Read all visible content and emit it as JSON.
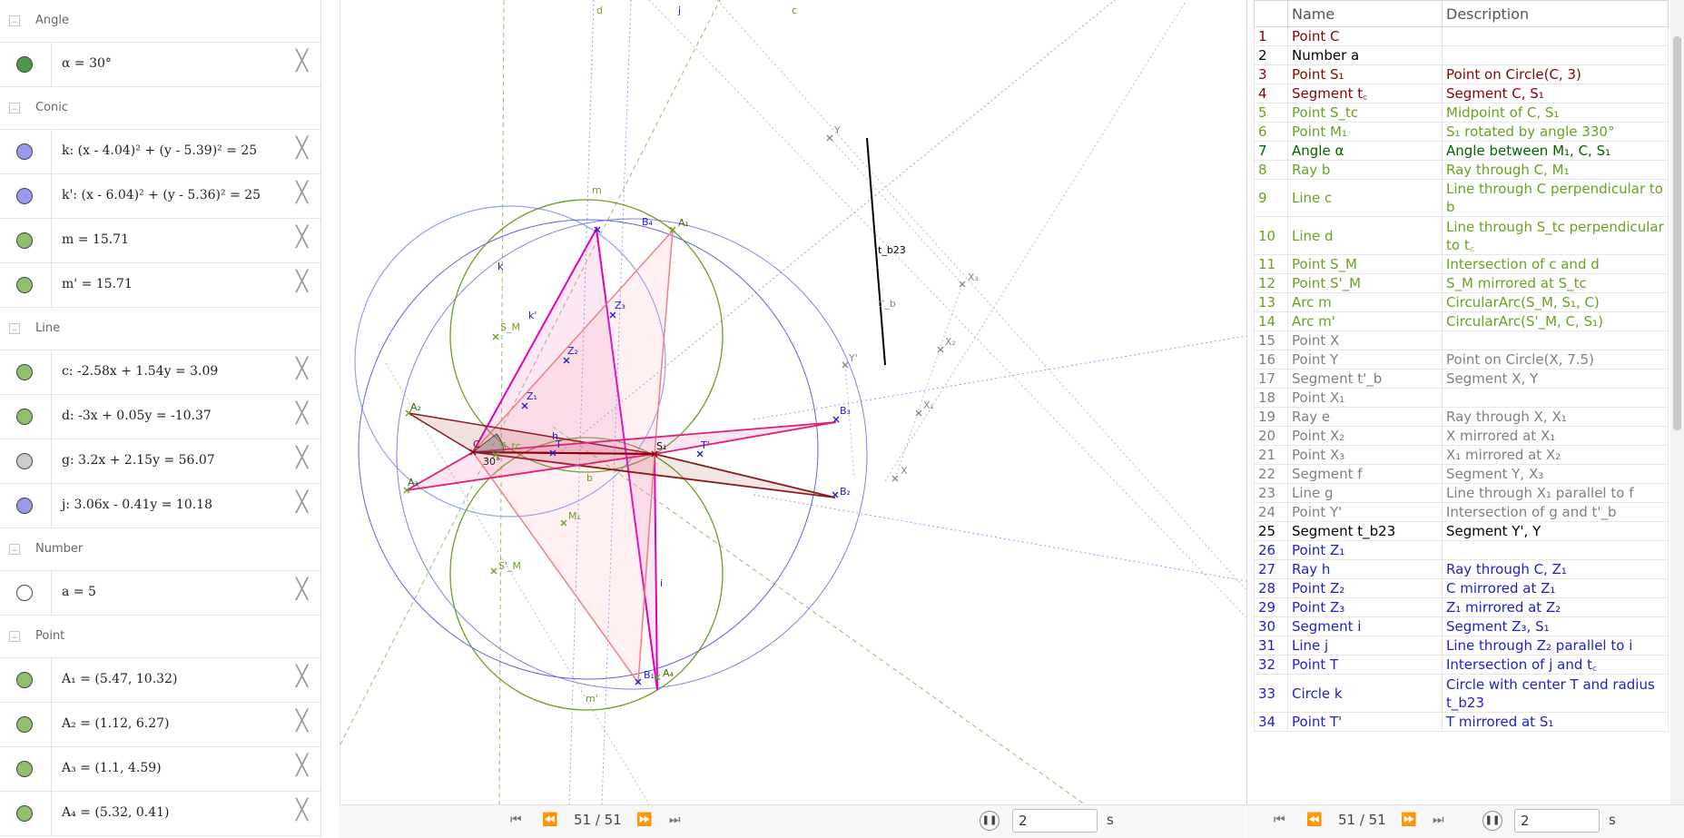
{
  "algebra": {
    "sections": [
      {
        "category": "Angle",
        "items": [
          {
            "expr": "α = 30°",
            "color": "#4a9a4a"
          }
        ]
      },
      {
        "category": "Conic",
        "items": [
          {
            "expr": "k: (x - 4.04)² + (y - 5.39)² = 25",
            "color": "#9999ee"
          },
          {
            "expr": "k': (x - 6.04)² + (y - 5.36)² = 25",
            "color": "#9999ee"
          },
          {
            "expr": "m = 15.71",
            "color": "#8fc06a"
          },
          {
            "expr": "m' = 15.71",
            "color": "#8fc06a"
          }
        ]
      },
      {
        "category": "Line",
        "items": [
          {
            "expr": "c: -2.58x + 1.54y = 3.09",
            "color": "#8fc06a"
          },
          {
            "expr": "d: -3x + 0.05y = -10.37",
            "color": "#8fc06a"
          },
          {
            "expr": "g: 3.2x + 2.15y = 56.07",
            "color": "#cccccc"
          },
          {
            "expr": "j: 3.06x - 0.41y = 10.18",
            "color": "#9999ee"
          }
        ]
      },
      {
        "category": "Number",
        "items": [
          {
            "expr": "a = 5",
            "color": "#ffffff"
          }
        ]
      },
      {
        "category": "Point",
        "items": [
          {
            "expr": "A₁ = (5.47, 10.32)",
            "color": "#8fc06a"
          },
          {
            "expr": "A₂ = (1.12, 6.27)",
            "color": "#8fc06a"
          },
          {
            "expr": "A₃ = (1.1, 4.59)",
            "color": "#8fc06a"
          },
          {
            "expr": "A₄ = (5.32, 0.41)",
            "color": "#8fc06a"
          }
        ]
      }
    ],
    "delete_symbol": "╳",
    "toggle_symbol": "–"
  },
  "graphics": {
    "labels": {
      "d": "d",
      "j": "j",
      "c": "c",
      "m": "m",
      "m_prime": "m'",
      "k": "k",
      "k_prime": "k'",
      "b": "b",
      "h": "h",
      "i": "i",
      "A1": "A₁",
      "A2": "A₂",
      "A3": "A₃",
      "A4": "A₄",
      "B1": "B₁",
      "B2": "B₂",
      "B3": "B₃",
      "B4": "B₄",
      "C": "C",
      "S1": "S₁",
      "T": "T",
      "T_prime": "T'",
      "Z1": "Z₁",
      "Z2": "Z₂",
      "Z3": "Z₃",
      "SM": "S_M",
      "S_prime_M": "S'_M",
      "M1": "M₁",
      "Stc": "S_tc",
      "angle": "30°",
      "X": "X",
      "X1": "X₁",
      "X2": "X₂",
      "X3": "X₃",
      "Y": "Y",
      "Y_prime": "Y'",
      "tb23": "t_b23",
      "t_prime_b": "t'_b"
    }
  },
  "playback": {
    "counter": "51 / 51",
    "speed_value": "2",
    "speed_unit": "s",
    "first_icon": "⏮",
    "prev_icon": "⏪",
    "next_icon": "⏩",
    "last_icon": "⏭",
    "pause_icon": "❚❚"
  },
  "protocol": {
    "header": {
      "name": "Name",
      "description": "Description"
    },
    "menu_icon": "⋮",
    "rows": [
      {
        "n": "1",
        "name": "Point C",
        "desc": "",
        "color": "#8b0000"
      },
      {
        "n": "2",
        "name": "Number a",
        "desc": "",
        "color": "#000000"
      },
      {
        "n": "3",
        "name": "Point S₁",
        "desc": "Point on Circle(C, 3)",
        "color": "#8b0000"
      },
      {
        "n": "4",
        "name": "Segment t꜀",
        "desc": "Segment C, S₁",
        "color": "#8b0000"
      },
      {
        "n": "5",
        "name": "Point S_tc",
        "desc": "Midpoint of C, S₁",
        "color": "#6aa121"
      },
      {
        "n": "6",
        "name": "Point M₁",
        "desc": "S₁ rotated by angle 330°",
        "color": "#6aa121"
      },
      {
        "n": "7",
        "name": "Angle α",
        "desc": "Angle between M₁, C, S₁",
        "color": "#006400"
      },
      {
        "n": "8",
        "name": "Ray b",
        "desc": "Ray through C, M₁",
        "color": "#6aa121"
      },
      {
        "n": "9",
        "name": "Line c",
        "desc": "Line through C perpendicular to b",
        "color": "#6aa121"
      },
      {
        "n": "10",
        "name": "Line d",
        "desc": "Line through S_tc perpendicular to t꜀",
        "color": "#6aa121"
      },
      {
        "n": "11",
        "name": "Point S_M",
        "desc": "Intersection of c and d",
        "color": "#6aa121"
      },
      {
        "n": "12",
        "name": "Point S'_M",
        "desc": "S_M mirrored at S_tc",
        "color": "#6aa121"
      },
      {
        "n": "13",
        "name": "Arc m",
        "desc": "CircularArc(S_M, S₁, C)",
        "color": "#6aa121"
      },
      {
        "n": "14",
        "name": "Arc m'",
        "desc": "CircularArc(S'_M, C, S₁)",
        "color": "#6aa121"
      },
      {
        "n": "15",
        "name": "Point X",
        "desc": "",
        "color": "#808080"
      },
      {
        "n": "16",
        "name": "Point Y",
        "desc": "Point on Circle(X, 7.5)",
        "color": "#808080"
      },
      {
        "n": "17",
        "name": "Segment t'_b",
        "desc": "Segment X, Y",
        "color": "#808080"
      },
      {
        "n": "18",
        "name": "Point X₁",
        "desc": "",
        "color": "#808080"
      },
      {
        "n": "19",
        "name": "Ray e",
        "desc": "Ray through X, X₁",
        "color": "#808080"
      },
      {
        "n": "20",
        "name": "Point X₂",
        "desc": "X mirrored at X₁",
        "color": "#808080"
      },
      {
        "n": "21",
        "name": "Point X₃",
        "desc": "X₁ mirrored at X₂",
        "color": "#808080"
      },
      {
        "n": "22",
        "name": "Segment f",
        "desc": "Segment Y, X₃",
        "color": "#808080"
      },
      {
        "n": "23",
        "name": "Line g",
        "desc": "Line through X₁ parallel to f",
        "color": "#808080"
      },
      {
        "n": "24",
        "name": "Point Y'",
        "desc": "Intersection of g and t'_b",
        "color": "#808080"
      },
      {
        "n": "25",
        "name": "Segment t_b23",
        "desc": "Segment Y', Y",
        "color": "#000000"
      },
      {
        "n": "26",
        "name": "Point Z₁",
        "desc": "",
        "color": "#2020cc"
      },
      {
        "n": "27",
        "name": "Ray h",
        "desc": "Ray through C, Z₁",
        "color": "#2020cc"
      },
      {
        "n": "28",
        "name": "Point Z₂",
        "desc": "C mirrored at Z₁",
        "color": "#2020cc"
      },
      {
        "n": "29",
        "name": "Point Z₃",
        "desc": "Z₁ mirrored at Z₂",
        "color": "#2020cc"
      },
      {
        "n": "30",
        "name": "Segment i",
        "desc": "Segment Z₃, S₁",
        "color": "#2020cc"
      },
      {
        "n": "31",
        "name": "Line j",
        "desc": "Line through Z₂ parallel to i",
        "color": "#2020cc"
      },
      {
        "n": "32",
        "name": "Point T",
        "desc": "Intersection of j and t꜀",
        "color": "#2020cc"
      },
      {
        "n": "33",
        "name": "Circle k",
        "desc": "Circle with center T and radius t_b23",
        "color": "#2020cc"
      },
      {
        "n": "34",
        "name": "Point T'",
        "desc": "T mirrored at S₁",
        "color": "#2020cc"
      }
    ]
  }
}
